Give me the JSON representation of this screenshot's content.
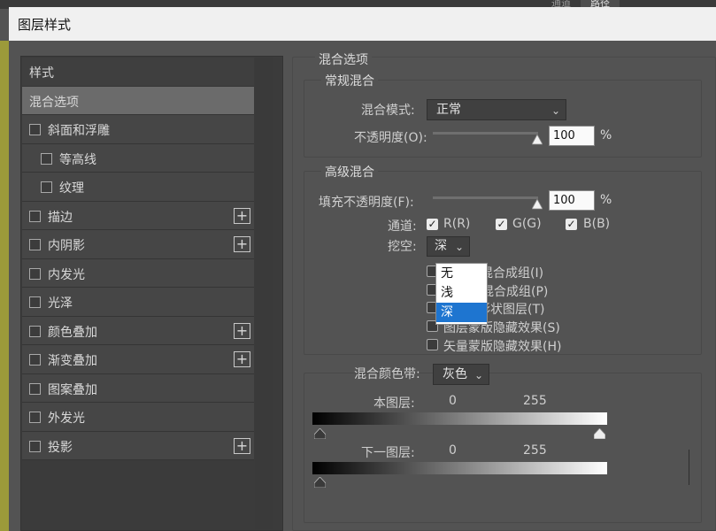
{
  "background": {
    "tabs": [
      "通道",
      "路径"
    ]
  },
  "dialog": {
    "title": "图层样式"
  },
  "styles_list": {
    "header": "样式",
    "items": [
      {
        "label": "混合选项",
        "checkbox": false,
        "plus": false,
        "selected": true,
        "indent": 0
      },
      {
        "label": "斜面和浮雕",
        "checkbox": true,
        "plus": false,
        "indent": 0
      },
      {
        "label": "等高线",
        "checkbox": true,
        "plus": false,
        "indent": 1
      },
      {
        "label": "纹理",
        "checkbox": true,
        "plus": false,
        "indent": 1
      },
      {
        "label": "描边",
        "checkbox": true,
        "plus": true,
        "indent": 0
      },
      {
        "label": "内阴影",
        "checkbox": true,
        "plus": true,
        "indent": 0
      },
      {
        "label": "内发光",
        "checkbox": true,
        "plus": false,
        "indent": 0
      },
      {
        "label": "光泽",
        "checkbox": true,
        "plus": false,
        "indent": 0
      },
      {
        "label": "颜色叠加",
        "checkbox": true,
        "plus": true,
        "indent": 0
      },
      {
        "label": "渐变叠加",
        "checkbox": true,
        "plus": true,
        "indent": 0
      },
      {
        "label": "图案叠加",
        "checkbox": true,
        "plus": false,
        "indent": 0
      },
      {
        "label": "外发光",
        "checkbox": true,
        "plus": false,
        "indent": 0
      },
      {
        "label": "投影",
        "checkbox": true,
        "plus": true,
        "indent": 0
      }
    ]
  },
  "blend_options": {
    "title": "混合选项",
    "general": {
      "title": "常规混合",
      "mode_label": "混合模式:",
      "mode_value": "正常",
      "opacity_label": "不透明度(O):",
      "opacity_value": "100",
      "opacity_unit": "%"
    },
    "advanced": {
      "title": "高级混合",
      "fill_label": "填充不透明度(F):",
      "fill_value": "100",
      "fill_unit": "%",
      "channels_label": "通道:",
      "channel_r": "R(R)",
      "channel_g": "G(G)",
      "channel_b": "B(B)",
      "knockout_label": "挖空:",
      "knockout_value": "深",
      "knockout_options": [
        "无",
        "浅",
        "深"
      ],
      "options": [
        "部效果混合成组(I)",
        "图层混合成组(P)",
        "形状图层(T)",
        "图层蒙版隐藏效果(S)",
        "矢量蒙版隐藏效果(H)"
      ]
    },
    "blend_if": {
      "label": "混合颜色带:",
      "value": "灰色",
      "this_layer_label": "本图层:",
      "this_layer_min": "0",
      "this_layer_max": "255",
      "underlying_label": "下一图层:",
      "underlying_min": "0",
      "underlying_max": "255"
    }
  },
  "colors": {
    "selected_highlight": "#1e75d0",
    "olive_background": "#9c9a3a"
  }
}
